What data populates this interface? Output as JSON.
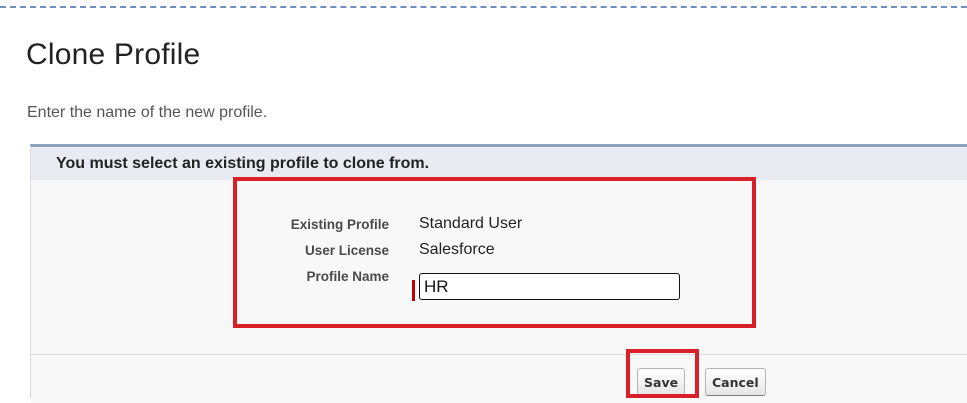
{
  "page": {
    "title": "Clone Profile",
    "instructions": "Enter the name of the new profile."
  },
  "panel": {
    "header": "You must select an existing profile to clone from."
  },
  "form": {
    "existing_profile_label": "Existing Profile",
    "existing_profile_value": "Standard User",
    "user_license_label": "User License",
    "user_license_value": "Salesforce",
    "profile_name_label": "Profile Name",
    "profile_name_value": "HR"
  },
  "buttons": {
    "save": "Save",
    "cancel": "Cancel"
  },
  "colors": {
    "highlight": "#d9202a",
    "required_marker": "#c00000",
    "panel_accent": "#8ea3bd"
  }
}
